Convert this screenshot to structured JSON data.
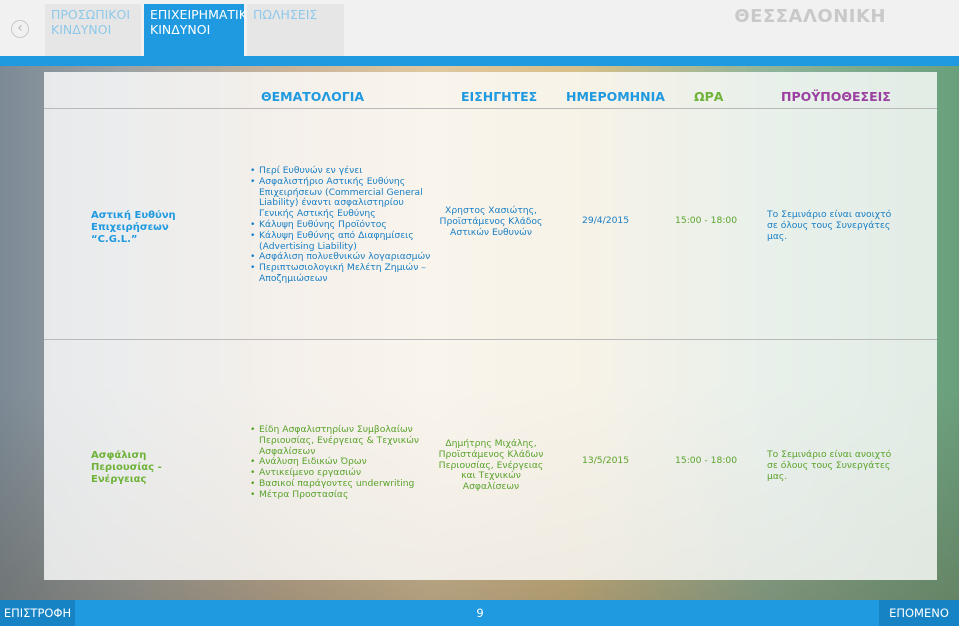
{
  "header": {
    "tabs": [
      {
        "label": "ΠΡΟΣΩΠΙΚΟΙ ΚΙΝΔΥΝΟΙ",
        "active": false
      },
      {
        "label": "ΕΠΙΧΕΙΡΗΜΑΤΙΚΟΙ ΚΙΝΔΥΝΟΙ",
        "active": true
      },
      {
        "label": "ΠΩΛΗΣΕΙΣ",
        "active": false
      }
    ],
    "city": "ΘΕΣΣΑΛΟΝΙΚΗ",
    "back_icon": "chevron-left-icon"
  },
  "table": {
    "headers": {
      "topic": "ΘΕΜΑΤΟΛΟΓΙΑ",
      "speakers": "ΕΙΣΗΓΗΤΕΣ",
      "date": "ΗΜΕΡΟΜΗΝΙΑ",
      "time": "ΩΡΑ",
      "prereq": "ΠΡΟΫΠΟΘΕΣΕΙΣ"
    },
    "rows": [
      {
        "title": "Αστική Ευθύνη Επιχειρήσεων “C.G.L.”",
        "items": [
          "Περί Ευθυνών εν γένει",
          "Ασφαλιστήριο Αστικής Ευθύνης Επιχειρήσεων (Commercial General Liability) έναντι ασφαλιστηρίου Γενικής Αστικής Ευθύνης",
          "Κάλυψη Ευθύνης Προϊόντος",
          "Κάλυψη Ευθύνης από Διαφημίσεις (Advertising Liability)",
          "Ασφάλιση πολυεθνικών λογαριασμών",
          "Περιπτωσιολογική Μελέτη Ζημιών – Αποζημιώσεων"
        ],
        "speaker": "Χρηστος Χασιώτης, Προϊστάμενος Κλάδος Αστικών Ευθυνών",
        "date": "29/4/2015",
        "time": "15:00 - 18:00",
        "prereq": "Το Σεμινάριο είναι ανοιχτό σε όλους τους Συνεργάτες μας."
      },
      {
        "title": "Ασφάλιση Περιουσίας - Ενέργειας",
        "items": [
          "Είδη Ασφαλιστηρίων Συμβολαίων Περιουσίας, Ενέργειας & Τεχνικών Ασφαλίσεων",
          "Ανάλυση Ειδικών Όρων",
          "Αντικείμενο εργασιών",
          "Βασικοί παράγοντες underwriting",
          "Μέτρα Προστασίας"
        ],
        "speaker": "Δημήτρης Μιχάλης, Προϊστάμενος Κλάδων Περιουσίας, Ενέργειας και Τεχνικών Ασφαλίσεων",
        "date": "13/5/2015",
        "time": "15:00 - 18:00",
        "prereq": "Το Σεμινάριο είναι ανοιχτό σε όλους τους Συνεργάτες μας."
      }
    ]
  },
  "footer": {
    "prev_label": "ΕΠΙΣΤΡΟΦΗ",
    "page_number": "9",
    "next_label": "ΕΠΟΜΕΝΟ"
  },
  "colors": {
    "accent_blue": "#1f9ae0",
    "green": "#6fb33a",
    "purple": "#9b3fa0"
  }
}
